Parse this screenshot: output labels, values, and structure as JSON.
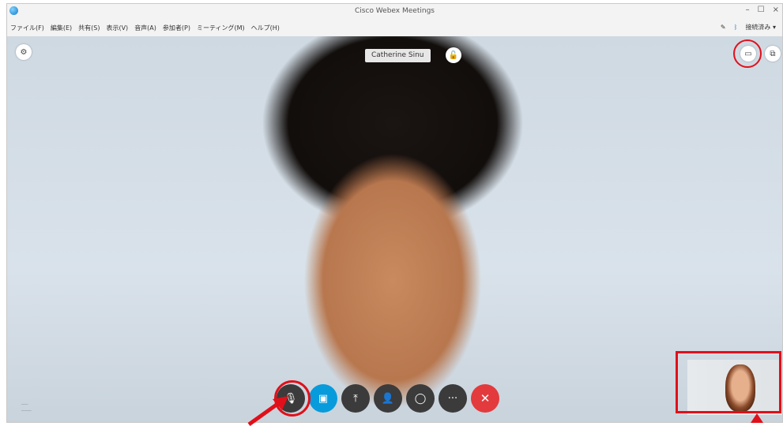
{
  "window": {
    "title": "Cisco Webex Meetings",
    "controls": [
      "–",
      "☐",
      "×"
    ]
  },
  "menu": {
    "items": [
      "ファイル(F)",
      "編集(E)",
      "共有(S)",
      "表示(V)",
      "音声(A)",
      "参加者(P)",
      "ミーティング(M)",
      "ヘルプ(H)"
    ],
    "status": "接続済み ▾"
  },
  "stage": {
    "participant_name": "Catherine Sinu",
    "watermark": "──\n───"
  },
  "controls": [
    {
      "name": "mute-button",
      "glyph": "🎙"
    },
    {
      "name": "video-button",
      "glyph": "▣"
    },
    {
      "name": "share-button",
      "glyph": "⤒"
    },
    {
      "name": "participants-button",
      "glyph": "👤"
    },
    {
      "name": "chat-button",
      "glyph": "◯"
    },
    {
      "name": "more-button",
      "glyph": "···"
    },
    {
      "name": "leave-button",
      "glyph": "✕"
    }
  ],
  "colors": {
    "highlight": "#e0101a",
    "video_active": "#079bdc",
    "leave": "#e33a3d",
    "control": "#3b3b3b"
  },
  "icons": [
    "settings-icon",
    "unlock-icon",
    "layout-icon",
    "expand-icon",
    "pen-icon",
    "bluetooth-icon"
  ]
}
